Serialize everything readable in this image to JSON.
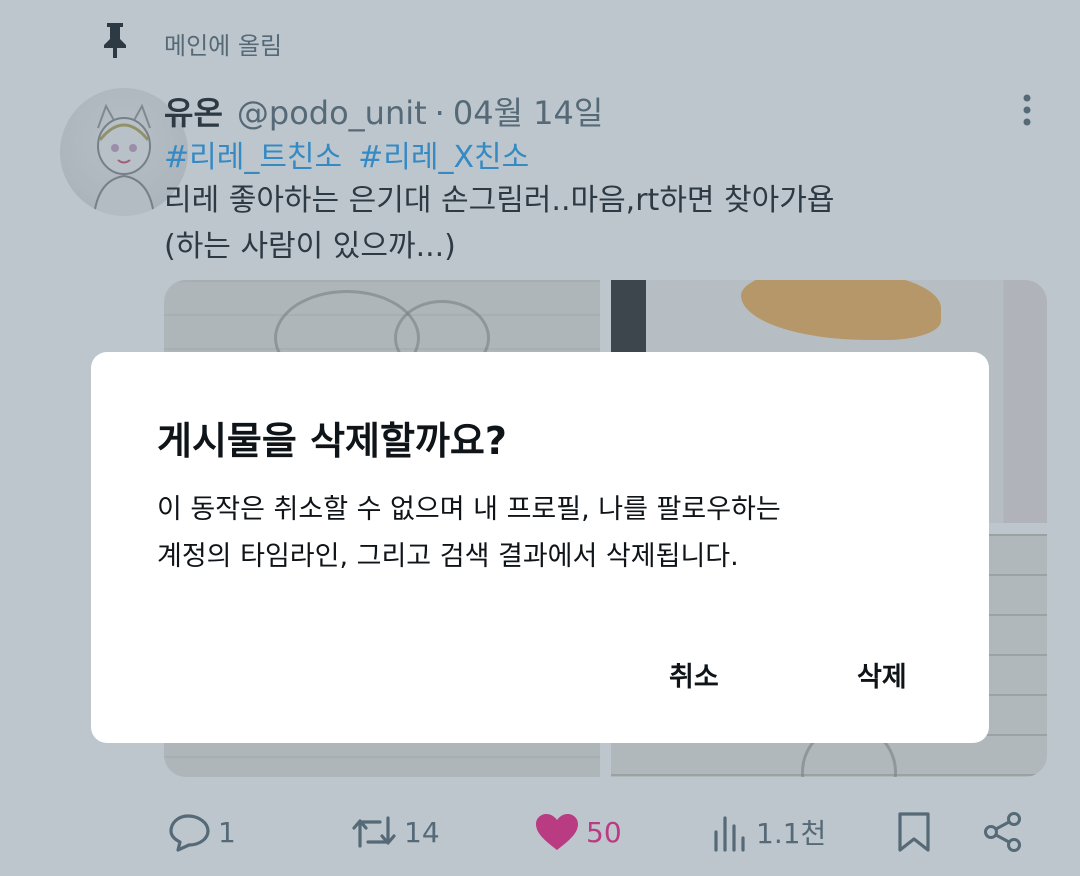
{
  "pinned": {
    "label": "메인에 올림",
    "icon": "pin-icon"
  },
  "tweet": {
    "user_name": "유온",
    "handle": "@podo_unit",
    "separator": "·",
    "date": "04월 14일",
    "hashtags": [
      "#리레_트친소",
      "#리레_X친소"
    ],
    "text_lines": [
      "리레 좋아하는 은기대 손그림러..마음,rt하면 찾아가욥",
      "(하는 사람이 있으까...)"
    ]
  },
  "actions": {
    "reply": {
      "icon": "reply-icon",
      "count": "1"
    },
    "retweet": {
      "icon": "retweet-icon",
      "count": "14"
    },
    "like": {
      "icon": "heart-icon",
      "count": "50",
      "color": "#f91880"
    },
    "views": {
      "icon": "views-icon",
      "count": "1.1천"
    },
    "bookmark": {
      "icon": "bookmark-icon"
    },
    "share": {
      "icon": "share-icon"
    }
  },
  "dialog": {
    "title": "게시물을 삭제할까요?",
    "message_lines": [
      "이 동작은 취소할 수 없으며 내 프로필, 나를 팔로우하는",
      "계정의 타임라인, 그리고 검색 결과에서 삭제됩니다."
    ],
    "cancel_label": "취소",
    "delete_label": "삭제"
  },
  "colors": {
    "accent": "#1d9bf0",
    "like": "#f91880",
    "secondary_text": "#536471",
    "overlay": "rgba(91,112,131,0.40)"
  }
}
